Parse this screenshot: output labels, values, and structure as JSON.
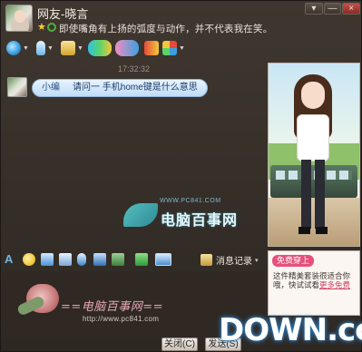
{
  "window": {
    "title": "网友-晓言",
    "signature": "即使嘴角有上扬的弧度与动作，并不代表我在笑。",
    "controls": {
      "menu": "▾",
      "minimize": "—",
      "close": "×"
    }
  },
  "toolbar": {
    "items": [
      {
        "name": "video",
        "icon": "camera-icon",
        "color": "#3aa0e0"
      },
      {
        "name": "voice",
        "icon": "microphone-icon",
        "color": "#6fb5e6"
      },
      {
        "name": "transfer-file",
        "icon": "folder-icon",
        "color": "#e8c24a"
      },
      {
        "name": "apps",
        "icon": "apps-grid-icon",
        "color": "#e64a8a"
      }
    ]
  },
  "chat": {
    "timestamp": "17:32:32",
    "messages": [
      {
        "sender": "小编",
        "text": "请问一 手机home键是什么意思"
      }
    ],
    "watermark": {
      "url": "WWW.PC841.COM",
      "brand": "电脑百事网"
    }
  },
  "format_bar": {
    "icons": [
      "font-icon",
      "emoji-icon",
      "shake-icon",
      "screenshot-icon",
      "voice-msg-icon",
      "music-icon",
      "image-icon",
      "gift-icon",
      "screen-share-icon"
    ],
    "history_label": "消息记录",
    "history_caret": "▾"
  },
  "input": {
    "stamp_text": "==电脑百事网==",
    "stamp_url": "http://www.pc841.com"
  },
  "ad": {
    "badge": "免费穿上",
    "line1": "这件精美套装很适合你",
    "line2_prefix": "哦，快试试看",
    "line2_link": "更多免费"
  },
  "buttons": {
    "close": "关闭(C)",
    "send": "发送(S)"
  },
  "logo": {
    "text": "DOWN",
    "suffix": ".cc"
  }
}
